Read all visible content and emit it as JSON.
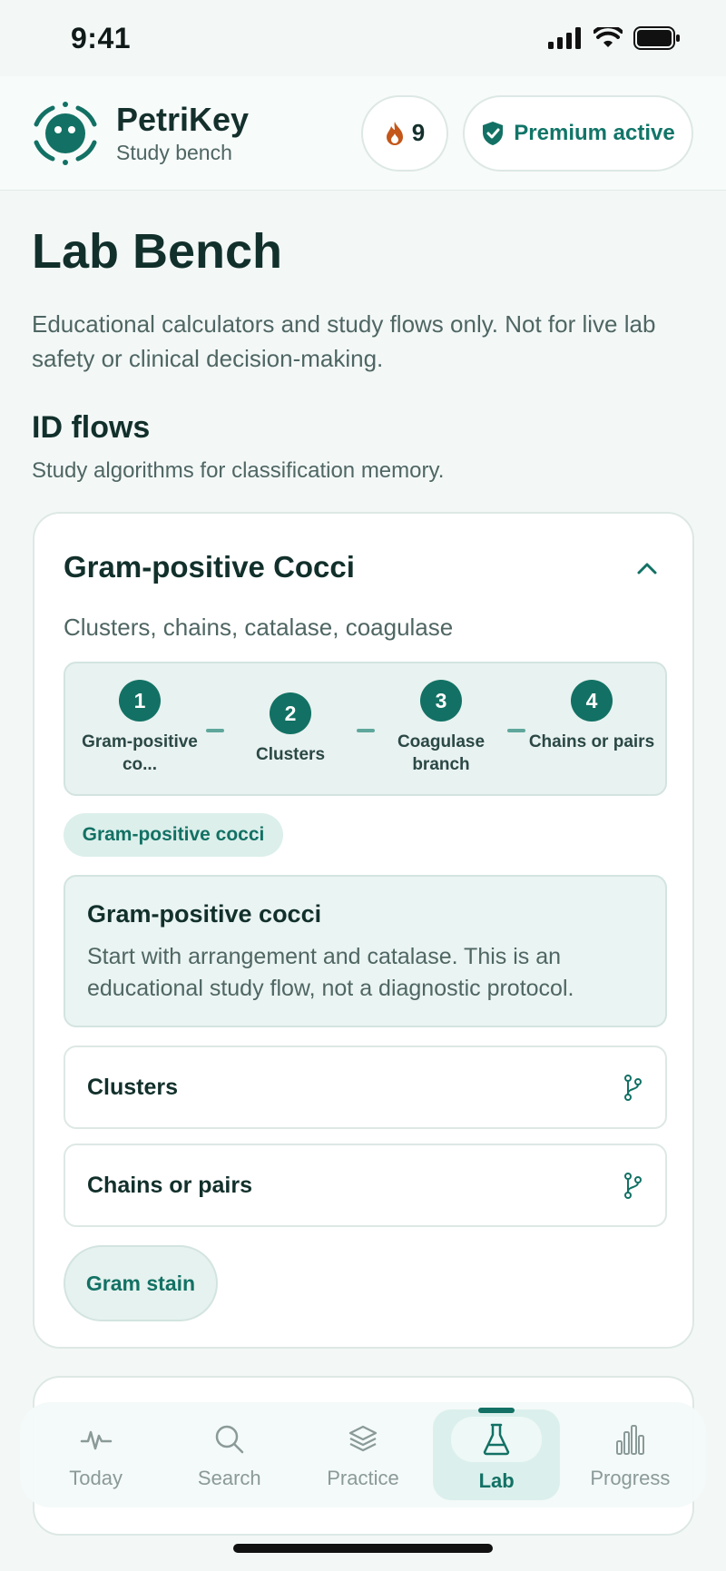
{
  "status": {
    "time": "9:41"
  },
  "header": {
    "brand": "PetriKey",
    "subtitle": "Study bench",
    "streak": "9",
    "premium": "Premium active"
  },
  "page": {
    "title": "Lab Bench",
    "description": "Educational calculators and study flows only. Not for live lab safety or clinical decision-making."
  },
  "section": {
    "title": "ID flows",
    "subtitle": "Study algorithms for classification memory."
  },
  "card": {
    "title": "Gram-positive Cocci",
    "subtitle": "Clusters, chains, catalase, coagulase",
    "steps": [
      {
        "num": "1",
        "label": "Gram-positive co..."
      },
      {
        "num": "2",
        "label": "Clusters"
      },
      {
        "num": "3",
        "label": "Coagulase branch"
      },
      {
        "num": "4",
        "label": "Chains or pairs"
      }
    ],
    "tag": "Gram-positive cocci",
    "info_title": "Gram-positive cocci",
    "info_text": "Start with arrangement and catalase. This is an educational study flow, not a diagnostic protocol.",
    "options": [
      {
        "label": "Clusters"
      },
      {
        "label": "Chains or pairs"
      }
    ],
    "back_chip": "Gram stain"
  },
  "tabs": [
    {
      "label": "Today",
      "icon": "pulse-icon"
    },
    {
      "label": "Search",
      "icon": "search-icon"
    },
    {
      "label": "Practice",
      "icon": "layers-icon"
    },
    {
      "label": "Lab",
      "icon": "flask-icon",
      "active": true
    },
    {
      "label": "Progress",
      "icon": "bar-chart-icon"
    }
  ],
  "colors": {
    "accent": "#127164",
    "streak": "#c4561a"
  }
}
